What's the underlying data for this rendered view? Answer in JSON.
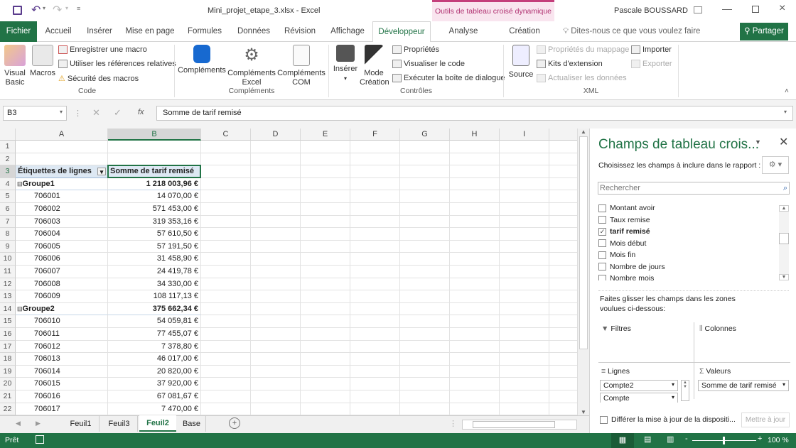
{
  "window": {
    "filename": "Mini_projet_etape_3.xlsx",
    "separator": "-",
    "app": "Excel",
    "context_title": "Outils de tableau croisé dynamique",
    "user": "Pascale BOUSSARD"
  },
  "tabs": [
    {
      "label": "Fichier"
    },
    {
      "label": "Accueil"
    },
    {
      "label": "Insérer"
    },
    {
      "label": "Mise en page"
    },
    {
      "label": "Formules"
    },
    {
      "label": "Données"
    },
    {
      "label": "Révision"
    },
    {
      "label": "Affichage"
    },
    {
      "label": "Développeur",
      "active": true
    },
    {
      "label": "Analyse"
    },
    {
      "label": "Création"
    }
  ],
  "tell_me": "Dites-nous ce que vous voulez faire",
  "share": "Partager",
  "ribbon": {
    "code": {
      "label": "Code",
      "visual_basic": [
        "Visual",
        "Basic"
      ],
      "macros": "Macros",
      "record": "Enregistrer une macro",
      "relative": "Utiliser les références relatives",
      "security": "Sécurité des macros"
    },
    "addins": {
      "label": "Compléments",
      "addins": "Compléments",
      "excel": [
        "Compléments",
        "Excel"
      ],
      "com": [
        "Compléments",
        "COM"
      ]
    },
    "controls": {
      "label": "Contrôles",
      "insert": "Insérer",
      "design": [
        "Mode",
        "Création"
      ],
      "properties": "Propriétés",
      "view_code": "Visualiser le code",
      "run_dialog": "Exécuter la boîte de dialogue"
    },
    "xml": {
      "label": "XML",
      "source": "Source",
      "map_props": "Propriétés du mappage",
      "packs": "Kits d'extension",
      "refresh": "Actualiser les données",
      "import": "Importer",
      "export": "Exporter"
    }
  },
  "formula": {
    "namebox": "B3",
    "fx": "fx",
    "value": "Somme de tarif remisé"
  },
  "columns": [
    "A",
    "B",
    "C",
    "D",
    "E",
    "F",
    "G",
    "H",
    "I"
  ],
  "rows": [
    {
      "n": "1",
      "a": "",
      "b": ""
    },
    {
      "n": "2",
      "a": "",
      "b": ""
    },
    {
      "n": "3",
      "a": "Étiquettes de lignes",
      "b": "Somme de tarif remisé",
      "type": "header"
    },
    {
      "n": "4",
      "a": "Groupe1",
      "b": "1 218 003,96 €",
      "type": "group"
    },
    {
      "n": "5",
      "a": "706001",
      "b": "14 070,00 €"
    },
    {
      "n": "6",
      "a": "706002",
      "b": "571 453,00 €"
    },
    {
      "n": "7",
      "a": "706003",
      "b": "319 353,16 €"
    },
    {
      "n": "8",
      "a": "706004",
      "b": "57 610,50 €"
    },
    {
      "n": "9",
      "a": "706005",
      "b": "57 191,50 €"
    },
    {
      "n": "10",
      "a": "706006",
      "b": "31 458,90 €"
    },
    {
      "n": "11",
      "a": "706007",
      "b": "24 419,78 €"
    },
    {
      "n": "12",
      "a": "706008",
      "b": "34 330,00 €"
    },
    {
      "n": "13",
      "a": "706009",
      "b": "108 117,13 €"
    },
    {
      "n": "14",
      "a": "Groupe2",
      "b": "375 662,34 €",
      "type": "group"
    },
    {
      "n": "15",
      "a": "706010",
      "b": "54 059,81 €"
    },
    {
      "n": "16",
      "a": "706011",
      "b": "77 455,07 €"
    },
    {
      "n": "17",
      "a": "706012",
      "b": "7 378,80 €"
    },
    {
      "n": "18",
      "a": "706013",
      "b": "46 017,00 €"
    },
    {
      "n": "19",
      "a": "706014",
      "b": "20 820,00 €"
    },
    {
      "n": "20",
      "a": "706015",
      "b": "37 920,00 €"
    },
    {
      "n": "21",
      "a": "706016",
      "b": "67 081,67 €"
    },
    {
      "n": "22",
      "a": "706017",
      "b": "7 470,00 €"
    }
  ],
  "sheets": [
    {
      "label": "Feuil1"
    },
    {
      "label": "Feuil3"
    },
    {
      "label": "Feuil2",
      "active": true
    },
    {
      "label": "Base"
    }
  ],
  "pane": {
    "title": "Champs de tableau crois...",
    "choose": "Choisissez les champs à inclure dans le rapport :",
    "search_placeholder": "Rechercher",
    "fields": [
      {
        "label": "Montant avoir",
        "checked": false
      },
      {
        "label": "Taux remise",
        "checked": false
      },
      {
        "label": "tarif remisé",
        "checked": true
      },
      {
        "label": "Mois début",
        "checked": false
      },
      {
        "label": "Mois fin",
        "checked": false
      },
      {
        "label": "Nombre de jours",
        "checked": false
      },
      {
        "label": "Nombre mois",
        "checked": false
      }
    ],
    "drag_hint": "Faites glisser les champs dans les zones voulues ci-dessous:",
    "filters": "Filtres",
    "columns": "Colonnes",
    "rows": "Lignes",
    "values": "Valeurs",
    "row_items": [
      "Compte2",
      "Compte"
    ],
    "value_items": [
      "Somme de tarif remisé"
    ],
    "defer": "Différer la mise à jour de la dispositi...",
    "update": "Mettre à jour"
  },
  "status": {
    "ready": "Prêt",
    "zoom": "100 %",
    "zoom_percent": 100
  },
  "colors": {
    "excel_green": "#217346",
    "context_pink": "#c43e7b",
    "selection": "#217346"
  }
}
